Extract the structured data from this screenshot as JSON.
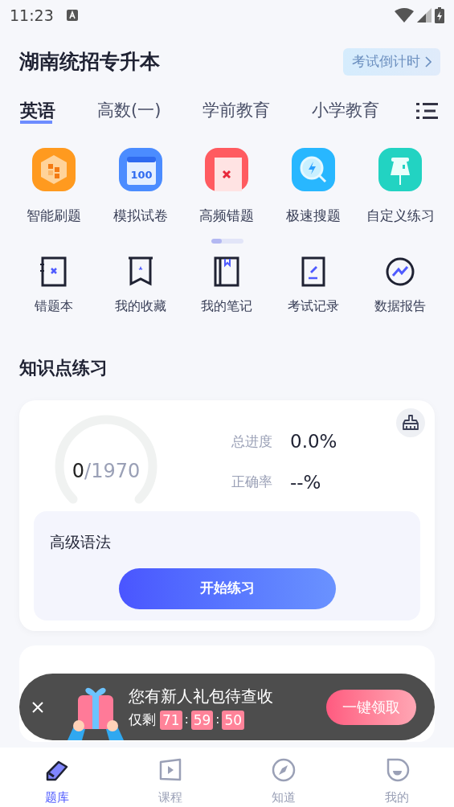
{
  "status_bar": {
    "time": "11:23"
  },
  "header": {
    "title": "湖南统招专升本",
    "countdown_button": "考试倒计时"
  },
  "tabs": [
    {
      "label": "英语",
      "selected": true
    },
    {
      "label": "高数(一)",
      "selected": false
    },
    {
      "label": "学前教育",
      "selected": false
    },
    {
      "label": "小学教育",
      "selected": false
    }
  ],
  "feature_grid": [
    {
      "label": "智能刷题",
      "kind": "smart"
    },
    {
      "label": "模拟试卷",
      "kind": "paper",
      "icon_text": "100"
    },
    {
      "label": "高频错题",
      "kind": "wrong"
    },
    {
      "label": "极速搜题",
      "kind": "search"
    },
    {
      "label": "自定义练习",
      "kind": "custom"
    }
  ],
  "pager": {
    "level": 0.33
  },
  "tools": [
    {
      "label": "错题本",
      "kind": "notebook"
    },
    {
      "label": "我的收藏",
      "kind": "bookmark"
    },
    {
      "label": "我的笔记",
      "kind": "notes"
    },
    {
      "label": "考试记录",
      "kind": "record"
    },
    {
      "label": "数据报告",
      "kind": "report"
    }
  ],
  "section_title": "知识点练习",
  "practice_card": {
    "done": "0",
    "total": "/1970",
    "stats": [
      {
        "label": "总进度",
        "value": "0.0%"
      },
      {
        "label": "正确率",
        "value": "--%"
      }
    ],
    "topic": "高级语法",
    "start_button": "开始练习"
  },
  "promo_banner": {
    "title": "您有新人礼包待查收",
    "prefix": "仅剩",
    "countdown": [
      "71",
      "59",
      "50"
    ],
    "separator": ":",
    "claim_button": "一键领取"
  },
  "bottom_nav": [
    {
      "label": "题库",
      "kind": "bank",
      "selected": true
    },
    {
      "label": "课程",
      "kind": "course",
      "selected": false
    },
    {
      "label": "知道",
      "kind": "compass",
      "selected": false
    },
    {
      "label": "我的",
      "kind": "me",
      "selected": false
    }
  ]
}
